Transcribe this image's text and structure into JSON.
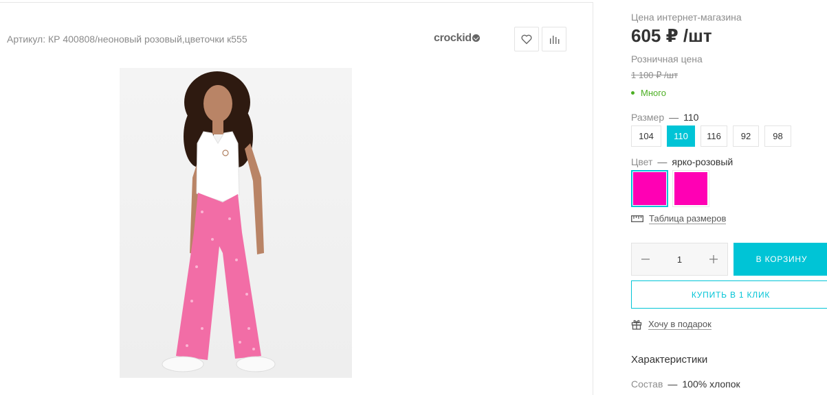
{
  "product": {
    "sku": "Артикул: КР 400808/неоновый розовый,цветочки к555",
    "brand": "crockid",
    "image_alt": "Девочка в белом топе и розовых брюках"
  },
  "pricing": {
    "online_label": "Цена интернет-магазина",
    "online_price": "605 ₽ /шт",
    "retail_label": "Розничная цена",
    "retail_price": "1 100 ₽ /шт",
    "stock": "Много",
    "stock_color": "#4caf23"
  },
  "size": {
    "label": "Размер",
    "selected": "110",
    "options": [
      "104",
      "110",
      "116",
      "92",
      "98"
    ]
  },
  "color": {
    "label": "Цвет",
    "selected": "ярко-розовый",
    "swatches": [
      "#ff00b4",
      "#ff00b4"
    ]
  },
  "size_table_link": "Таблица размеров",
  "quantity": {
    "value": "1"
  },
  "buttons": {
    "cart": "В КОРЗИНУ",
    "one_click": "КУПИТЬ В 1 КЛИК",
    "gift": "Хочу в подарок"
  },
  "characteristics": {
    "title": "Характеристики",
    "composition_label": "Состав",
    "composition_value": "100% хлопок"
  },
  "icons": {
    "favorite": "heart-icon",
    "compare": "bar-chart-icon",
    "ruler": "ruler-icon",
    "gift": "gift-icon",
    "minus": "minus-icon",
    "plus": "plus-icon"
  },
  "accent_color": "#00c4d6"
}
